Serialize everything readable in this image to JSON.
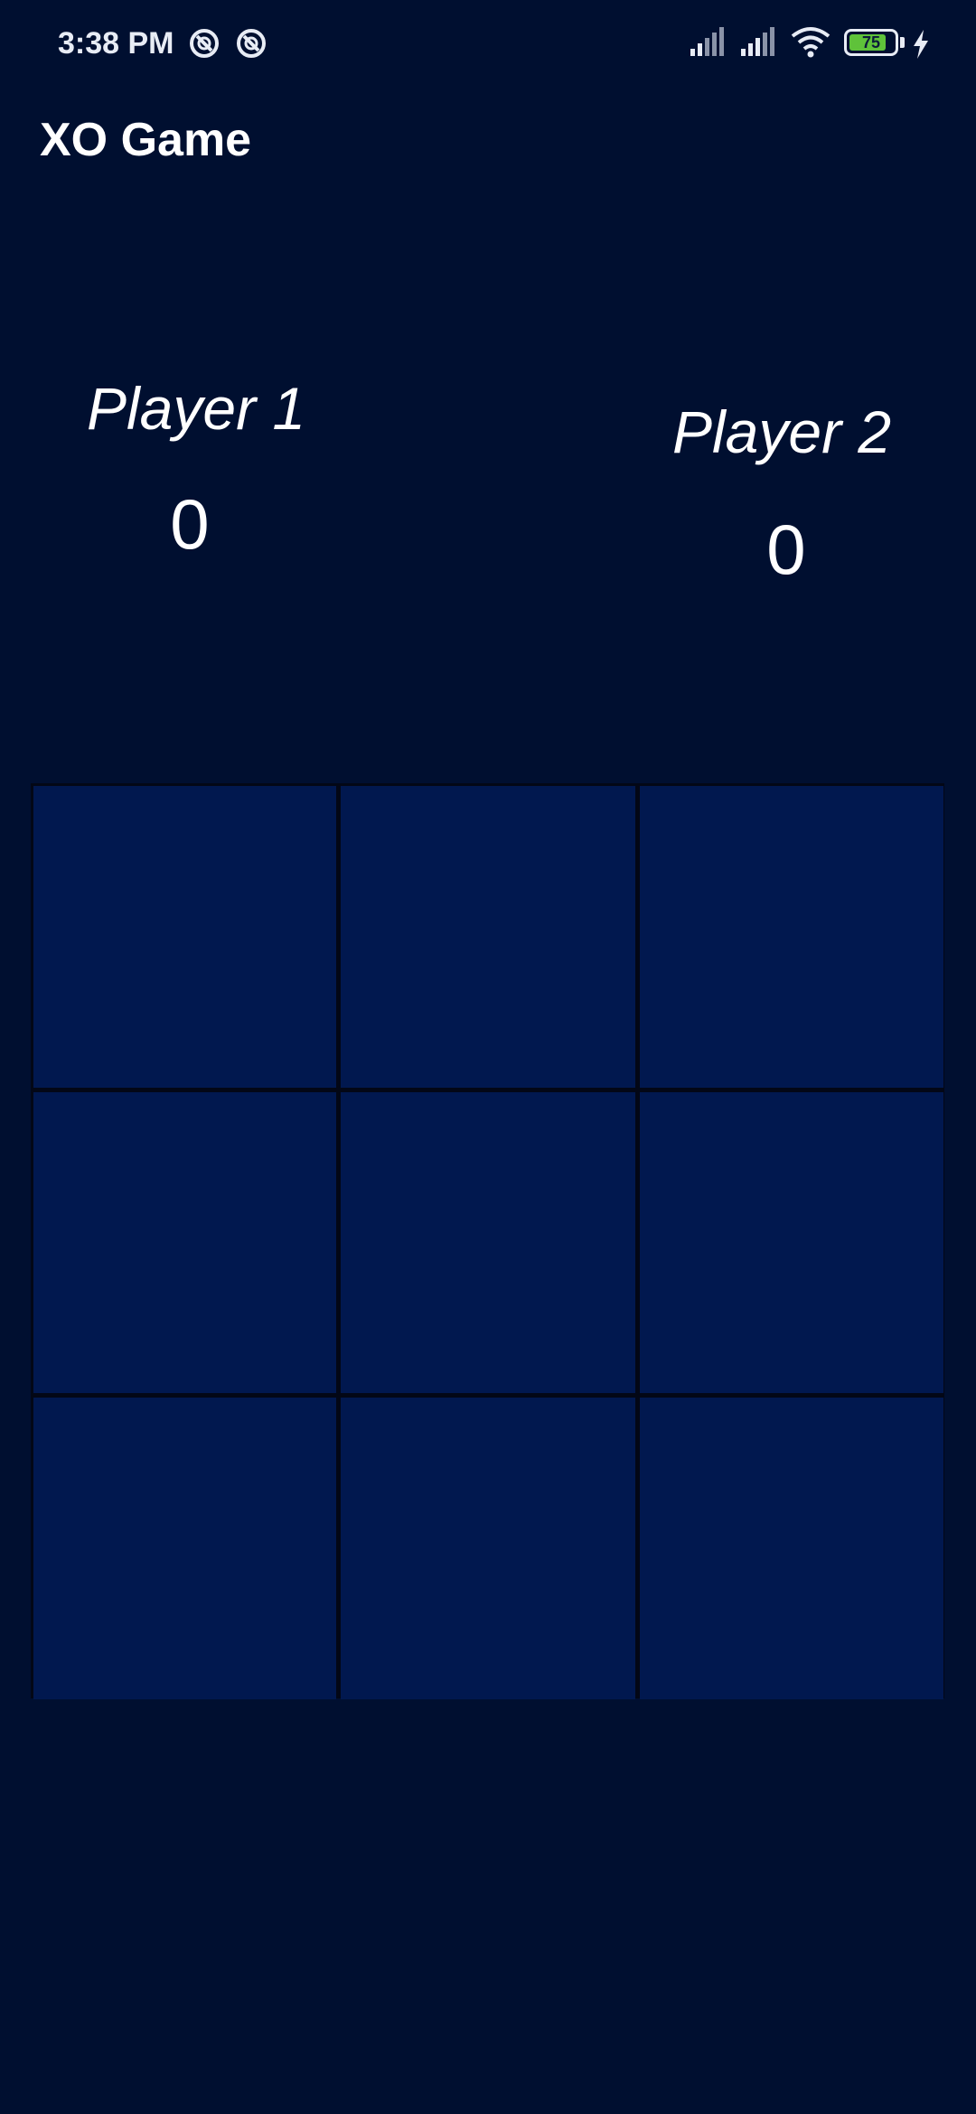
{
  "status_bar": {
    "time": "3:38 PM",
    "notification_icons": [
      "app-notification-icon",
      "app-notification-icon"
    ],
    "indicator_icons": [
      "signal-icon",
      "signal-icon",
      "wifi-icon",
      "battery-icon",
      "charging-icon"
    ],
    "battery_percent": "75"
  },
  "app_bar": {
    "title": "XO Game"
  },
  "players": [
    {
      "name": "Player 1",
      "score": "0"
    },
    {
      "name": "Player 2",
      "score": "0"
    }
  ],
  "board": {
    "rows": 3,
    "cols": 3,
    "cells": [
      "",
      "",
      "",
      "",
      "",
      "",
      "",
      "",
      ""
    ]
  },
  "colors": {
    "background": "#000f30",
    "cell": "#01184f",
    "grid_line": "#030716",
    "text": "#ffffff",
    "battery_fill": "#5fc23a"
  }
}
